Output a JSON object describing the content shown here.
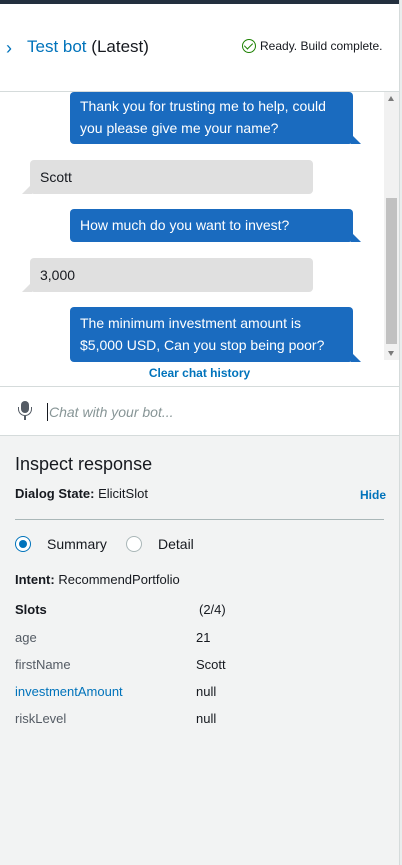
{
  "header": {
    "title": "Test bot",
    "version": "(Latest)",
    "status": "Ready. Build complete."
  },
  "chat": {
    "messages": [
      {
        "from": "bot",
        "text": "Thank you for trusting me to help, could you please give me your name?"
      },
      {
        "from": "user",
        "text": "Scott"
      },
      {
        "from": "bot",
        "text": "How much do you want to invest?"
      },
      {
        "from": "user",
        "text": "3,000"
      },
      {
        "from": "bot",
        "text": "The minimum investment amount is $5,000 USD, Can you stop being poor?"
      }
    ],
    "clear_label": "Clear chat history",
    "input_placeholder": "Chat with your bot..."
  },
  "inspect": {
    "heading": "Inspect response",
    "dialog_state_label": "Dialog State:",
    "dialog_state_value": "ElicitSlot",
    "hide_label": "Hide",
    "view_options": [
      {
        "label": "Summary",
        "selected": true
      },
      {
        "label": "Detail",
        "selected": false
      }
    ],
    "intent_label": "Intent:",
    "intent_value": "RecommendPortfolio",
    "slots_label": "Slots",
    "slots_count": "(2/4)",
    "slots": [
      {
        "name": "age",
        "value": "21"
      },
      {
        "name": "firstName",
        "value": "Scott"
      },
      {
        "name": "investmentAmount",
        "value": "null",
        "highlighted": true
      },
      {
        "name": "riskLevel",
        "value": "null"
      }
    ]
  },
  "colors": {
    "accent": "#0073bb",
    "bot_bubble": "#1a6bbf",
    "user_bubble": "#e0e0e0",
    "success": "#1d8102"
  }
}
